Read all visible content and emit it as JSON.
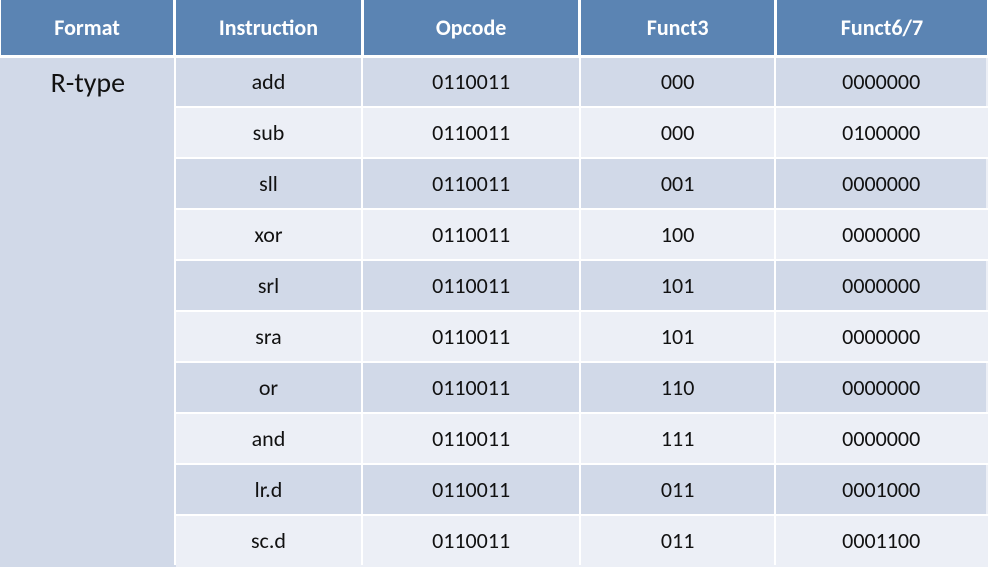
{
  "chart_data": {
    "type": "table",
    "title": "",
    "columns": [
      "Format",
      "Instruction",
      "Opcode",
      "Funct3",
      "Funct6/7"
    ],
    "rows": [
      [
        "R-type",
        "add",
        "0110011",
        "000",
        "0000000"
      ],
      [
        "R-type",
        "sub",
        "0110011",
        "000",
        "0100000"
      ],
      [
        "R-type",
        "sll",
        "0110011",
        "001",
        "0000000"
      ],
      [
        "R-type",
        "xor",
        "0110011",
        "100",
        "0000000"
      ],
      [
        "R-type",
        "srl",
        "0110011",
        "101",
        "0000000"
      ],
      [
        "R-type",
        "sra",
        "0110011",
        "101",
        "0000000"
      ],
      [
        "R-type",
        "or",
        "0110011",
        "110",
        "0000000"
      ],
      [
        "R-type",
        "and",
        "0110011",
        "111",
        "0000000"
      ],
      [
        "R-type",
        "lr.d",
        "0110011",
        "011",
        "0001000"
      ],
      [
        "R-type",
        "sc.d",
        "0110011",
        "011",
        "0001100"
      ]
    ]
  },
  "headers": {
    "format": "Format",
    "instruction": "Instruction",
    "opcode": "Opcode",
    "funct3": "Funct3",
    "funct67": "Funct6/7"
  },
  "format_label": "R-type",
  "rows": [
    {
      "instr": "add",
      "op": "0110011",
      "f3": "000",
      "f67": "0000000"
    },
    {
      "instr": "sub",
      "op": "0110011",
      "f3": "000",
      "f67": "0100000"
    },
    {
      "instr": "sll",
      "op": "0110011",
      "f3": "001",
      "f67": "0000000"
    },
    {
      "instr": "xor",
      "op": "0110011",
      "f3": "100",
      "f67": "0000000"
    },
    {
      "instr": "srl",
      "op": "0110011",
      "f3": "101",
      "f67": "0000000"
    },
    {
      "instr": "sra",
      "op": "0110011",
      "f3": "101",
      "f67": "0000000"
    },
    {
      "instr": "or",
      "op": "0110011",
      "f3": "110",
      "f67": "0000000"
    },
    {
      "instr": "and",
      "op": "0110011",
      "f3": "111",
      "f67": "0000000"
    },
    {
      "instr": "lr.d",
      "op": "0110011",
      "f3": "011",
      "f67": "0001000"
    },
    {
      "instr": "sc.d",
      "op": "0110011",
      "f3": "011",
      "f67": "0001100"
    }
  ]
}
